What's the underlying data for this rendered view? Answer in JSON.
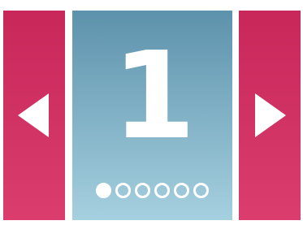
{
  "slider": {
    "current_slide": "1",
    "slide_count": 6,
    "active_index": 0,
    "prev_icon": "triangle-left-icon",
    "next_icon": "triangle-right-icon"
  },
  "colors": {
    "nav_panel": "#d0335f",
    "slide_bg_top": "#5d92ac",
    "slide_bg_bottom": "#a5d0df",
    "foreground": "#ffffff"
  }
}
